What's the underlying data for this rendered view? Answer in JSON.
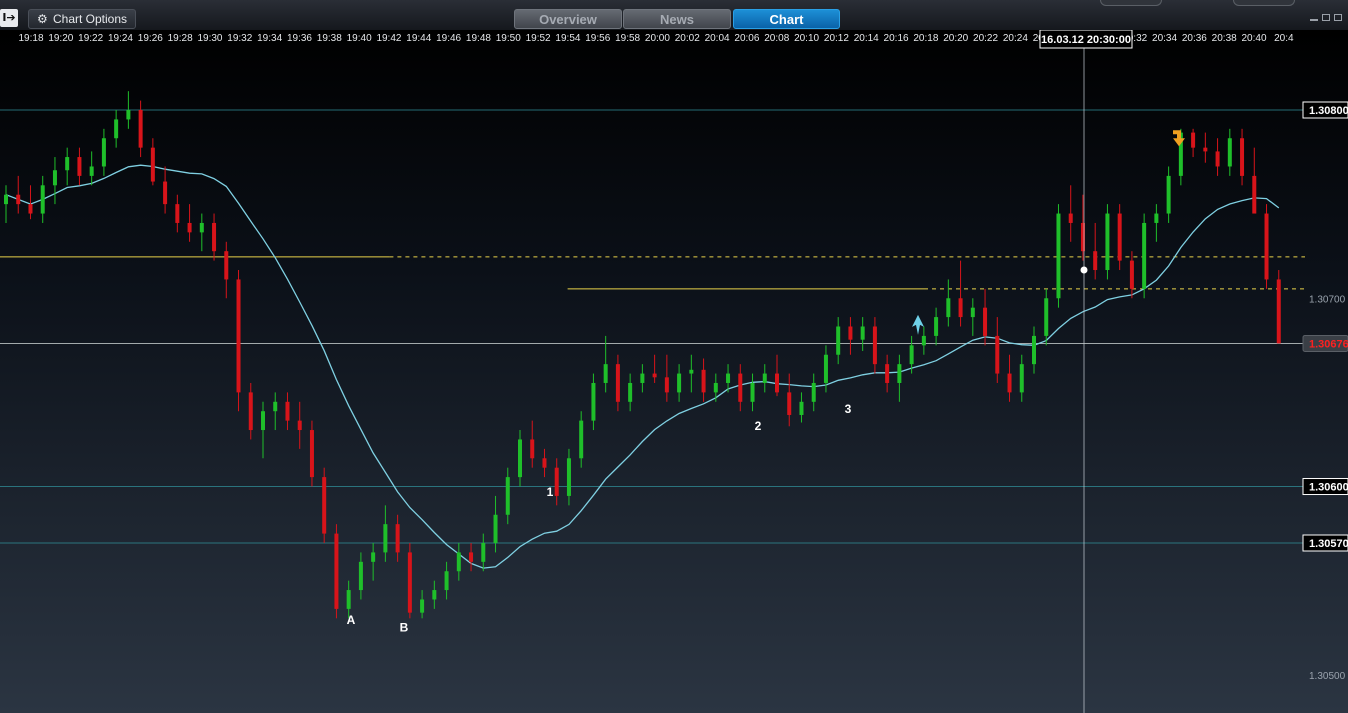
{
  "toolbar": {
    "options_label": "Chart Options",
    "collapse_label": "I➔",
    "tabs": [
      {
        "label": "Overview",
        "active": false
      },
      {
        "label": "News",
        "active": false
      },
      {
        "label": "Chart",
        "active": true
      }
    ],
    "gear_icon": "gear-icon"
  },
  "colors": {
    "up": "#1fbf2a",
    "down": "#d8141a",
    "ma": "#7fd0e2",
    "support_line": "#e8d24a",
    "horizontal_line": "#9fb6c2",
    "crosshair": "#c8d0d8",
    "accent_tab": "#0a7bc8"
  },
  "chart_data": {
    "type": "candlestick",
    "instrument_timeframe": "1 minute",
    "cursor_label": "16.03.12 20:30:00",
    "time_ticks": [
      "19:18",
      "19:20",
      "19:22",
      "19:24",
      "19:26",
      "19:28",
      "19:30",
      "19:32",
      "19:34",
      "19:36",
      "19:38",
      "19:40",
      "19:42",
      "19:44",
      "19:46",
      "19:48",
      "19:50",
      "19:52",
      "19:54",
      "19:56",
      "19:58",
      "20:00",
      "20:02",
      "20:04",
      "20:06",
      "20:08",
      "20:10",
      "20:12",
      "20:14",
      "20:16",
      "20:18",
      "20:20",
      "20:22",
      "20:24",
      "20:26",
      "20:28",
      "20:30",
      "20:32",
      "20:34",
      "20:36",
      "20:38",
      "20:40",
      "20:4"
    ],
    "ylim": [
      1.3049,
      1.30855
    ],
    "price_ticks": [
      {
        "label": "1.30800",
        "value": 1.308,
        "boxed": true
      },
      {
        "label": "1.30700",
        "value": 1.307,
        "boxed": false
      },
      {
        "label": "1.30676",
        "value": 1.30676,
        "boxed": true,
        "current": true
      },
      {
        "label": "1.30600",
        "value": 1.306,
        "boxed": true
      },
      {
        "label": "1.30570",
        "value": 1.3057,
        "boxed": true
      },
      {
        "label": "1.30500",
        "value": 1.305,
        "boxed": false
      }
    ],
    "horizontal_lines": [
      1.308,
      1.30676,
      1.306,
      1.3057
    ],
    "support_resistance": [
      {
        "value": 1.30722,
        "from_time": "19:18",
        "to_time": "20:42",
        "solid_until": "19:42"
      },
      {
        "value": 1.30705,
        "from_time": "19:54",
        "to_time": "20:42",
        "solid_until": "20:18"
      }
    ],
    "annotations": [
      {
        "text": "A",
        "time": "19:40",
        "price": 1.30527
      },
      {
        "text": "B",
        "time": "19:44",
        "price": 1.30523
      },
      {
        "text": "1",
        "time": "19:52",
        "price": 1.30595
      },
      {
        "text": "2",
        "time": "20:08",
        "price": 1.3063
      },
      {
        "text": "3",
        "time": "20:14",
        "price": 1.30639
      }
    ],
    "markers": [
      {
        "kind": "buy-arrow",
        "time": "20:18",
        "price": 1.30688,
        "color": "#6fd0e8"
      },
      {
        "kind": "sell-arrow",
        "time": "20:36",
        "price": 1.30785,
        "color": "#f0a020"
      },
      {
        "kind": "cursor-dot",
        "time": "20:30",
        "price": 1.30715,
        "color": "#ffffff"
      }
    ],
    "start_time": "19:18",
    "candles": [
      [
        1.3075,
        1.3076,
        1.3074,
        1.30755
      ],
      [
        1.30755,
        1.30765,
        1.30745,
        1.3075
      ],
      [
        1.3075,
        1.3076,
        1.30742,
        1.30745
      ],
      [
        1.30745,
        1.30765,
        1.3074,
        1.3076
      ],
      [
        1.3076,
        1.30775,
        1.3075,
        1.30768
      ],
      [
        1.30768,
        1.3078,
        1.3076,
        1.30775
      ],
      [
        1.30775,
        1.3078,
        1.3076,
        1.30765
      ],
      [
        1.30765,
        1.30778,
        1.3076,
        1.3077
      ],
      [
        1.3077,
        1.3079,
        1.30765,
        1.30785
      ],
      [
        1.30785,
        1.308,
        1.3078,
        1.30795
      ],
      [
        1.30795,
        1.3081,
        1.3079,
        1.308
      ],
      [
        1.308,
        1.30805,
        1.30775,
        1.3078
      ],
      [
        1.3078,
        1.30785,
        1.3076,
        1.30762
      ],
      [
        1.30762,
        1.3077,
        1.30745,
        1.3075
      ],
      [
        1.3075,
        1.30755,
        1.30735,
        1.3074
      ],
      [
        1.3074,
        1.3075,
        1.3073,
        1.30735
      ],
      [
        1.30735,
        1.30745,
        1.30725,
        1.3074
      ],
      [
        1.3074,
        1.30745,
        1.3072,
        1.30725
      ],
      [
        1.30725,
        1.3073,
        1.307,
        1.3071
      ],
      [
        1.3071,
        1.30715,
        1.3064,
        1.3065
      ],
      [
        1.3065,
        1.30655,
        1.30625,
        1.3063
      ],
      [
        1.3063,
        1.30645,
        1.30615,
        1.3064
      ],
      [
        1.3064,
        1.3065,
        1.3063,
        1.30645
      ],
      [
        1.30645,
        1.3065,
        1.3063,
        1.30635
      ],
      [
        1.30635,
        1.30645,
        1.3062,
        1.3063
      ],
      [
        1.3063,
        1.30635,
        1.306,
        1.30605
      ],
      [
        1.30605,
        1.3061,
        1.3057,
        1.30575
      ],
      [
        1.30575,
        1.3058,
        1.3053,
        1.30535
      ],
      [
        1.30535,
        1.3055,
        1.3053,
        1.30545
      ],
      [
        1.30545,
        1.30565,
        1.3054,
        1.3056
      ],
      [
        1.3056,
        1.3057,
        1.3055,
        1.30565
      ],
      [
        1.30565,
        1.3059,
        1.3056,
        1.3058
      ],
      [
        1.3058,
        1.30585,
        1.3056,
        1.30565
      ],
      [
        1.30565,
        1.3057,
        1.3053,
        1.30533
      ],
      [
        1.30533,
        1.30545,
        1.3053,
        1.3054
      ],
      [
        1.3054,
        1.3055,
        1.30535,
        1.30545
      ],
      [
        1.30545,
        1.3056,
        1.3054,
        1.30555
      ],
      [
        1.30555,
        1.3057,
        1.3055,
        1.30565
      ],
      [
        1.30565,
        1.3057,
        1.30555,
        1.3056
      ],
      [
        1.3056,
        1.30575,
        1.30555,
        1.3057
      ],
      [
        1.3057,
        1.30595,
        1.30565,
        1.30585
      ],
      [
        1.30585,
        1.3061,
        1.3058,
        1.30605
      ],
      [
        1.30605,
        1.3063,
        1.306,
        1.30625
      ],
      [
        1.30625,
        1.30635,
        1.3061,
        1.30615
      ],
      [
        1.30615,
        1.3062,
        1.30605,
        1.3061
      ],
      [
        1.3061,
        1.30615,
        1.3059,
        1.30595
      ],
      [
        1.30595,
        1.3062,
        1.3059,
        1.30615
      ],
      [
        1.30615,
        1.3064,
        1.3061,
        1.30635
      ],
      [
        1.30635,
        1.3066,
        1.3063,
        1.30655
      ],
      [
        1.30655,
        1.3068,
        1.3065,
        1.30665
      ],
      [
        1.30665,
        1.3067,
        1.3064,
        1.30645
      ],
      [
        1.30645,
        1.3066,
        1.3064,
        1.30655
      ],
      [
        1.30655,
        1.30665,
        1.3065,
        1.3066
      ],
      [
        1.3066,
        1.3067,
        1.30655,
        1.30658
      ],
      [
        1.30658,
        1.3067,
        1.30645,
        1.3065
      ],
      [
        1.3065,
        1.30665,
        1.30645,
        1.3066
      ],
      [
        1.3066,
        1.3067,
        1.3065,
        1.30662
      ],
      [
        1.30662,
        1.30668,
        1.30645,
        1.3065
      ],
      [
        1.3065,
        1.3066,
        1.30645,
        1.30655
      ],
      [
        1.30655,
        1.30665,
        1.3065,
        1.3066
      ],
      [
        1.3066,
        1.30665,
        1.3064,
        1.30645
      ],
      [
        1.30645,
        1.3066,
        1.3064,
        1.30655
      ],
      [
        1.30655,
        1.30665,
        1.3065,
        1.3066
      ],
      [
        1.3066,
        1.3067,
        1.30648,
        1.3065
      ],
      [
        1.3065,
        1.3066,
        1.30632,
        1.30638
      ],
      [
        1.30638,
        1.3065,
        1.30634,
        1.30645
      ],
      [
        1.30645,
        1.3066,
        1.3064,
        1.30655
      ],
      [
        1.30655,
        1.30675,
        1.3065,
        1.3067
      ],
      [
        1.3067,
        1.3069,
        1.30665,
        1.30685
      ],
      [
        1.30685,
        1.3069,
        1.3067,
        1.30678
      ],
      [
        1.30678,
        1.3069,
        1.30672,
        1.30685
      ],
      [
        1.30685,
        1.3069,
        1.3066,
        1.30665
      ],
      [
        1.30665,
        1.3067,
        1.3065,
        1.30655
      ],
      [
        1.30655,
        1.3067,
        1.30645,
        1.30665
      ],
      [
        1.30665,
        1.3068,
        1.3066,
        1.30675
      ],
      [
        1.30675,
        1.30685,
        1.3067,
        1.3068
      ],
      [
        1.3068,
        1.30695,
        1.30675,
        1.3069
      ],
      [
        1.3069,
        1.3071,
        1.30685,
        1.307
      ],
      [
        1.307,
        1.3072,
        1.30685,
        1.3069
      ],
      [
        1.3069,
        1.307,
        1.3068,
        1.30695
      ],
      [
        1.30695,
        1.30705,
        1.30675,
        1.3068
      ],
      [
        1.3068,
        1.3069,
        1.30655,
        1.3066
      ],
      [
        1.3066,
        1.3067,
        1.30645,
        1.3065
      ],
      [
        1.3065,
        1.3067,
        1.30645,
        1.30665
      ],
      [
        1.30665,
        1.30685,
        1.3066,
        1.3068
      ],
      [
        1.3068,
        1.30705,
        1.30675,
        1.307
      ],
      [
        1.307,
        1.3075,
        1.30695,
        1.30745
      ],
      [
        1.30745,
        1.3076,
        1.3073,
        1.3074
      ],
      [
        1.3074,
        1.30755,
        1.3072,
        1.30725
      ],
      [
        1.30725,
        1.3074,
        1.3071,
        1.30715
      ],
      [
        1.30715,
        1.3075,
        1.3071,
        1.30745
      ],
      [
        1.30745,
        1.3075,
        1.30715,
        1.3072
      ],
      [
        1.3072,
        1.30725,
        1.307,
        1.30705
      ],
      [
        1.30705,
        1.30745,
        1.307,
        1.3074
      ],
      [
        1.3074,
        1.3075,
        1.3073,
        1.30745
      ],
      [
        1.30745,
        1.3077,
        1.3074,
        1.30765
      ],
      [
        1.30765,
        1.3079,
        1.3076,
        1.30788
      ],
      [
        1.30788,
        1.3079,
        1.30775,
        1.3078
      ],
      [
        1.3078,
        1.30788,
        1.30772,
        1.30778
      ],
      [
        1.30778,
        1.30785,
        1.30765,
        1.3077
      ],
      [
        1.3077,
        1.3079,
        1.30765,
        1.30785
      ],
      [
        1.30785,
        1.3079,
        1.3076,
        1.30765
      ],
      [
        1.30765,
        1.3078,
        1.3075,
        1.30745
      ],
      [
        1.30745,
        1.3075,
        1.30705,
        1.3071
      ],
      [
        1.3071,
        1.30715,
        1.30676,
        1.30676
      ]
    ],
    "ma_line": true
  }
}
